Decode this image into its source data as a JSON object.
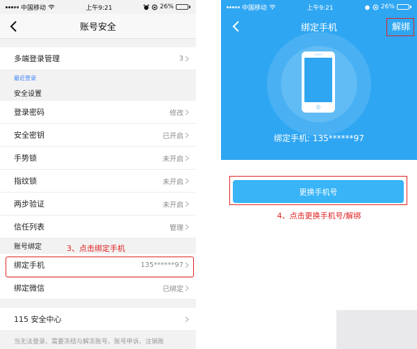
{
  "left": {
    "status": {
      "carrier": "中国移动",
      "time": "上午9:21",
      "battery": "26%",
      "battery_level": 0.26
    },
    "nav": {
      "title": "账号安全"
    },
    "multi_login": {
      "label": "多端登录管理",
      "value": "3"
    },
    "recent_login": "最近登录",
    "security_section": "安全设置",
    "security_rows": [
      {
        "label": "登录密码",
        "value": "修改"
      },
      {
        "label": "安全密钥",
        "value": "已开启"
      },
      {
        "label": "手势锁",
        "value": "未开启"
      },
      {
        "label": "指纹锁",
        "value": "未开启"
      },
      {
        "label": "两步验证",
        "value": "未开启"
      },
      {
        "label": "信任列表",
        "value": "管理"
      }
    ],
    "binding_section": "账号绑定",
    "bind_phone": {
      "label": "绑定手机",
      "value": "135******97"
    },
    "bind_wechat": {
      "label": "绑定微信",
      "value": "已绑定"
    },
    "security_center": {
      "label": "115 安全中心",
      "value": ""
    },
    "footer_note": "当无法登录、需要冻结与解冻账号、账号申诉、注销账",
    "annotation": "3、点击绑定手机"
  },
  "right": {
    "status": {
      "carrier": "中国移动",
      "time": "上午9:21",
      "battery": "26%",
      "battery_level": 0.26
    },
    "nav": {
      "title": "绑定手机",
      "unbind": "解绑"
    },
    "bound_phone_line": "绑定手机: 135******97",
    "change_button": "更换手机号",
    "annotation": "4、点击更换手机号/解绑"
  },
  "colors": {
    "accent_blue": "#2fa6f2",
    "button_blue": "#38b4f7",
    "annotation_red": "#e02020",
    "link_blue": "#3b82f6",
    "battery_yellow": "#f2c400"
  }
}
